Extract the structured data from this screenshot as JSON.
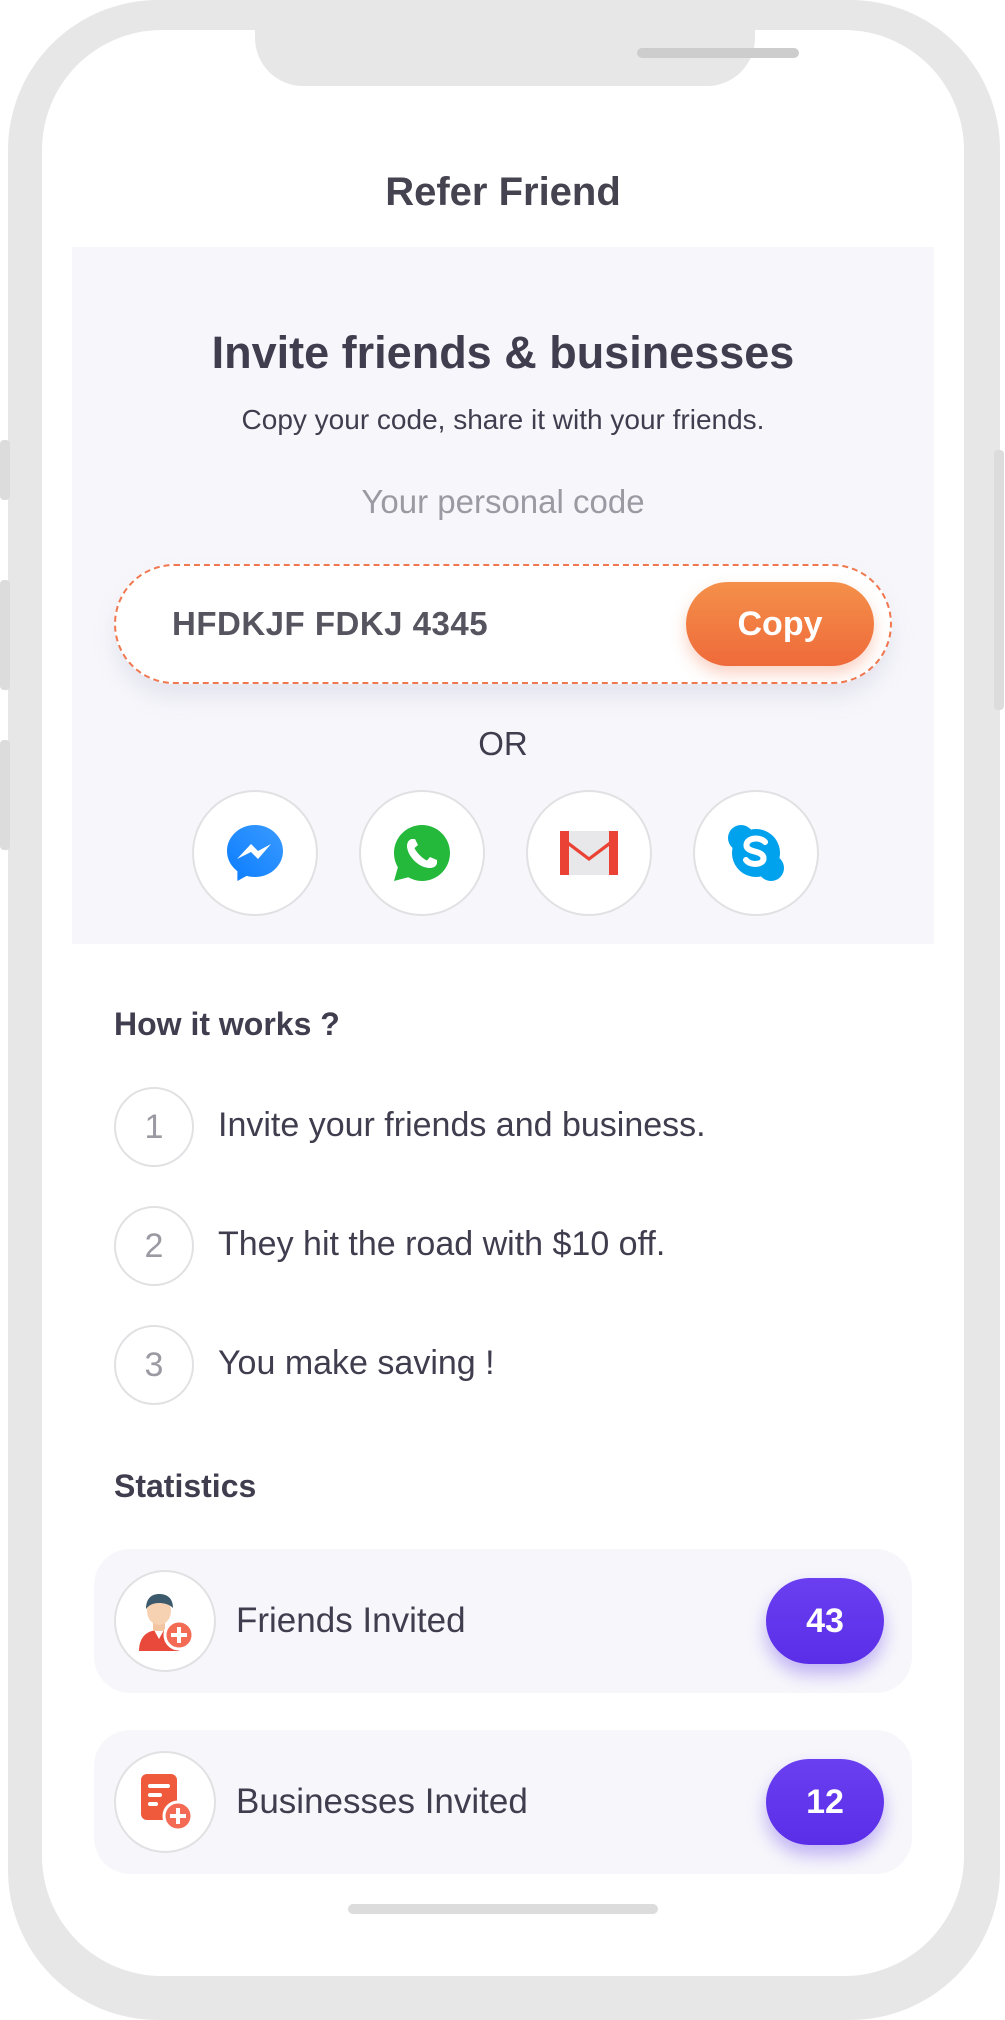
{
  "header": {
    "title": "Refer Friend"
  },
  "invite": {
    "heading": "Invite friends & businesses",
    "subtitle": "Copy your code, share it with your friends.",
    "code_label": "Your personal code",
    "code_value": "HFDKJF FDKJ 4345",
    "copy_label": "Copy",
    "or_label": "OR",
    "share_options": [
      {
        "icon": "messenger-icon"
      },
      {
        "icon": "whatsapp-icon"
      },
      {
        "icon": "gmail-icon"
      },
      {
        "icon": "skype-icon"
      }
    ]
  },
  "how_it_works": {
    "title": "How it works ?",
    "steps": [
      {
        "number": "1",
        "text": "Invite your friends and business."
      },
      {
        "number": "2",
        "text": "They hit the road with $10 off."
      },
      {
        "number": "3",
        "text": "You make saving !"
      }
    ]
  },
  "statistics": {
    "title": "Statistics",
    "items": [
      {
        "icon": "add-user-icon",
        "label": "Friends Invited",
        "count": "43"
      },
      {
        "icon": "add-business-icon",
        "label": "Businesses Invited",
        "count": "12"
      }
    ]
  },
  "colors": {
    "accent_orange": "#ef6a3a",
    "accent_purple": "#5a2ee8",
    "panel_background": "#f7f7fb",
    "text_dark": "#3f3d4e",
    "text_muted": "#9b9aa3"
  }
}
